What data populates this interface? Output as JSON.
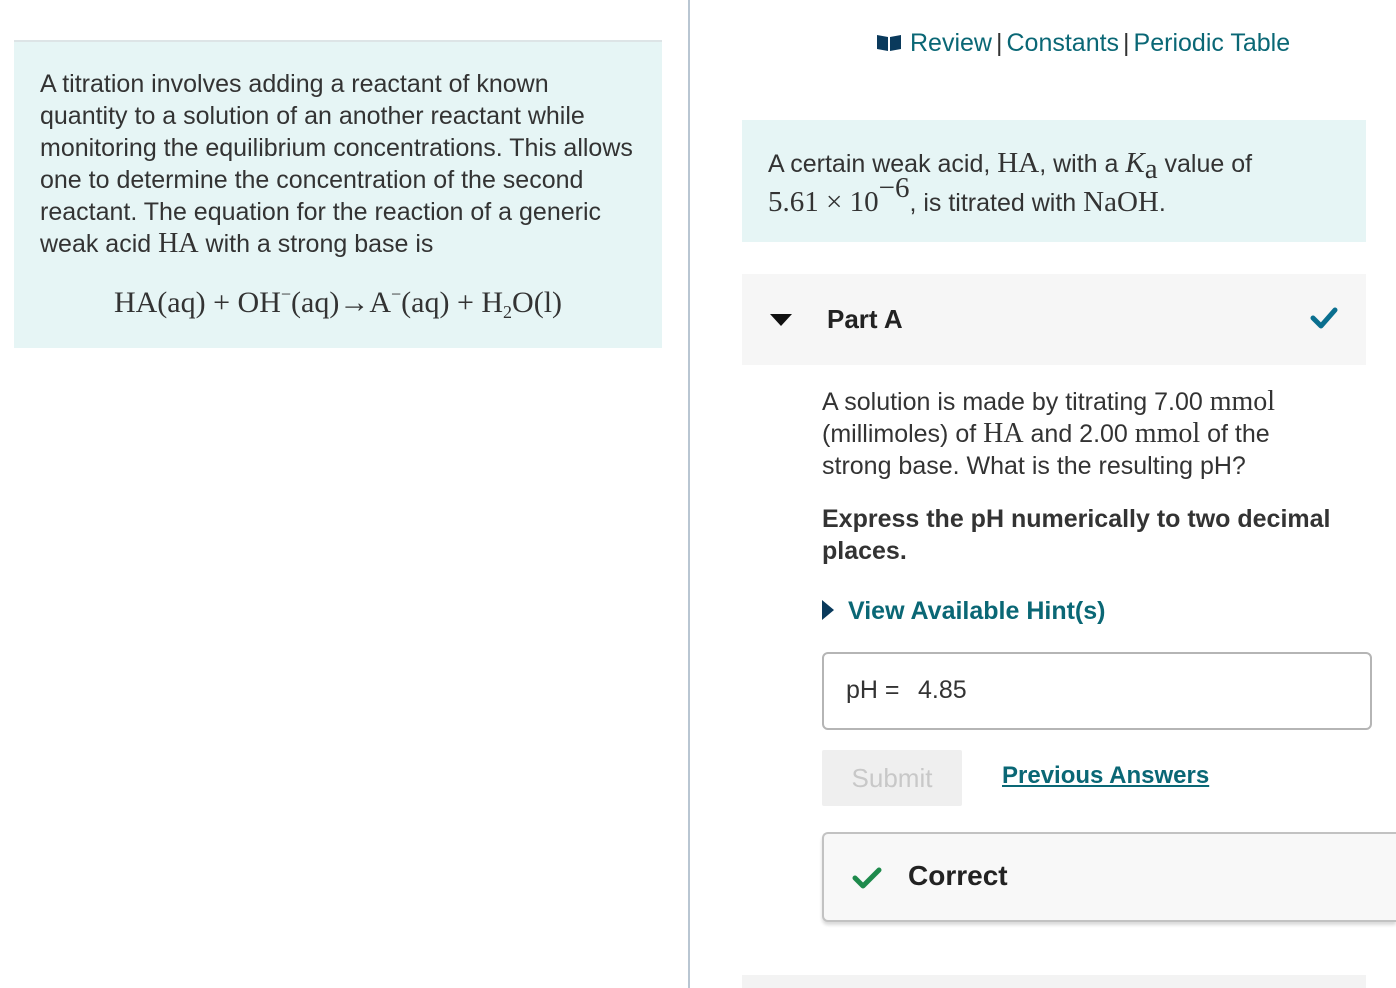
{
  "intro": {
    "text_1": "A titration involves adding a reactant of known quantity to a solution of an another reactant while monitoring the equilibrium concentrations. This allows one to determine the concentration of the second reactant. The equation for the reaction of a generic weak acid ",
    "acid_symbol": "HA",
    "text_2": " with a strong base is",
    "equation": {
      "ha": "HA(aq)",
      "plus_1": " + ",
      "oh": "OH",
      "oh_sup": "−",
      "oh_state": "(aq)",
      "arrow": "→",
      "a": "A",
      "a_sup": "−",
      "a_state": "(aq)",
      "plus_2": " + ",
      "h2o_h": "H",
      "h2o_sub": "2",
      "h2o_rest": "O(l)"
    }
  },
  "top_links": {
    "icon": "book-icon",
    "review": "Review",
    "sep_1": "|",
    "constants": "Constants",
    "sep_2": "|",
    "periodic_table": "Periodic Table"
  },
  "problem": {
    "text_1": "A certain weak acid, ",
    "acid_symbol": "HA",
    "text_2": ", with a ",
    "ka_k": "K",
    "ka_sub": "a",
    "text_3": " value of",
    "ka_mantissa": "5.61 × 10",
    "ka_exponent": "−6",
    "text_4": ", is titrated with ",
    "base": "NaOH",
    "text_5": "."
  },
  "part": {
    "caret_icon": "caret-down-icon",
    "title": "Part A",
    "status_icon": "checkmark-icon"
  },
  "question": {
    "text_1": "A solution is made by titrating 7.00 ",
    "unit_1": "mmol",
    "text_2": " (millimoles) of ",
    "acid_symbol": "HA",
    "text_3": " and 2.00 ",
    "unit_2": "mmol",
    "text_4": " of the strong base. What is the resulting pH?"
  },
  "instruction": "Express the pH numerically to two decimal places.",
  "hints": {
    "caret_icon": "caret-right-icon",
    "label": "View Available Hint(s)"
  },
  "answer": {
    "label": "pH = ",
    "value": "4.85"
  },
  "actions": {
    "submit": "Submit",
    "previous_answers": "Previous Answers"
  },
  "feedback": {
    "icon": "checkmark-icon",
    "text": "Correct"
  },
  "colors": {
    "panel_bg": "#e6f5f5",
    "link": "#0a6775",
    "check_blue": "#0a6f8f",
    "check_green": "#1e8a4c"
  }
}
